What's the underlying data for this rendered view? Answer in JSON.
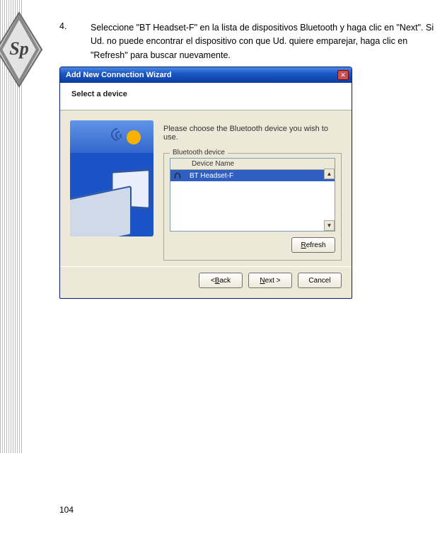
{
  "step": {
    "number": "4.",
    "text": "Seleccione \"BT Headset-F\" en la lista de dispositivos Bluetooth y haga clic en \"Next\". Si Ud. no puede encontrar el dispositivo con que Ud. quiere emparejar, haga clic en \"Refresh\" para buscar nuevamente."
  },
  "wizard": {
    "title": "Add New Connection Wizard",
    "subheader": "Select a device",
    "instruction": "Please choose the Bluetooth device you wish to use.",
    "group_legend": "Bluetooth device",
    "list_header": "Device Name",
    "selected_device": "BT Headset-F",
    "buttons": {
      "refresh": "Refresh",
      "back": "< Back",
      "next": "Next >",
      "cancel": "Cancel"
    }
  },
  "page_number": "104"
}
